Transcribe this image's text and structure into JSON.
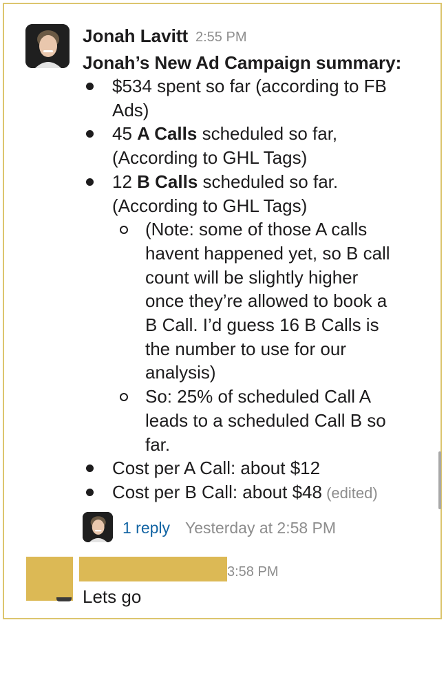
{
  "message": {
    "sender": "Jonah Lavitt",
    "time": "2:55 PM",
    "title": "Jonah’s New Ad Campaign summary:",
    "bullets": [
      {
        "lines": [
          {
            "parts": [
              {
                "text": "$534 spent so far (according to FB"
              }
            ]
          },
          {
            "parts": [
              {
                "text": "Ads)"
              }
            ]
          }
        ]
      },
      {
        "lines": [
          {
            "parts": [
              {
                "text": "45 "
              },
              {
                "text": "A Calls",
                "bold": true
              },
              {
                "text": " scheduled so far,"
              }
            ]
          },
          {
            "parts": [
              {
                "text": "(According to GHL Tags)"
              }
            ]
          }
        ]
      },
      {
        "lines": [
          {
            "parts": [
              {
                "text": "12 "
              },
              {
                "text": "B Calls",
                "bold": true
              },
              {
                "text": " scheduled so far."
              }
            ]
          },
          {
            "parts": [
              {
                "text": "(According to GHL Tags)"
              }
            ]
          }
        ],
        "sub_bullets": [
          {
            "lines": [
              "(Note: some of those A calls",
              "havent happened yet, so B call",
              "count will be slightly higher",
              "once they’re allowed to book a",
              "B Call. I’d guess 16 B Calls is",
              "the number to use for our",
              "analysis)"
            ]
          },
          {
            "lines": [
              "So: 25% of scheduled Call A",
              "leads to a scheduled Call B so",
              "far."
            ]
          }
        ]
      },
      {
        "lines": [
          {
            "parts": [
              {
                "text": "Cost per A Call: about $12"
              }
            ]
          }
        ]
      },
      {
        "lines": [
          {
            "parts": [
              {
                "text": "Cost per B Call: about $48"
              }
            ]
          }
        ],
        "edited_label": "(edited)"
      }
    ]
  },
  "thread": {
    "reply_count": "1 reply",
    "last_reply": "Yesterday at 2:58 PM"
  },
  "second_message": {
    "time": "3:58 PM",
    "text": "Lets go"
  },
  "colors": {
    "frame_border": "#dcc56e",
    "redaction": "#dcb955",
    "link": "#1264a3",
    "muted": "#8d8d8d"
  }
}
